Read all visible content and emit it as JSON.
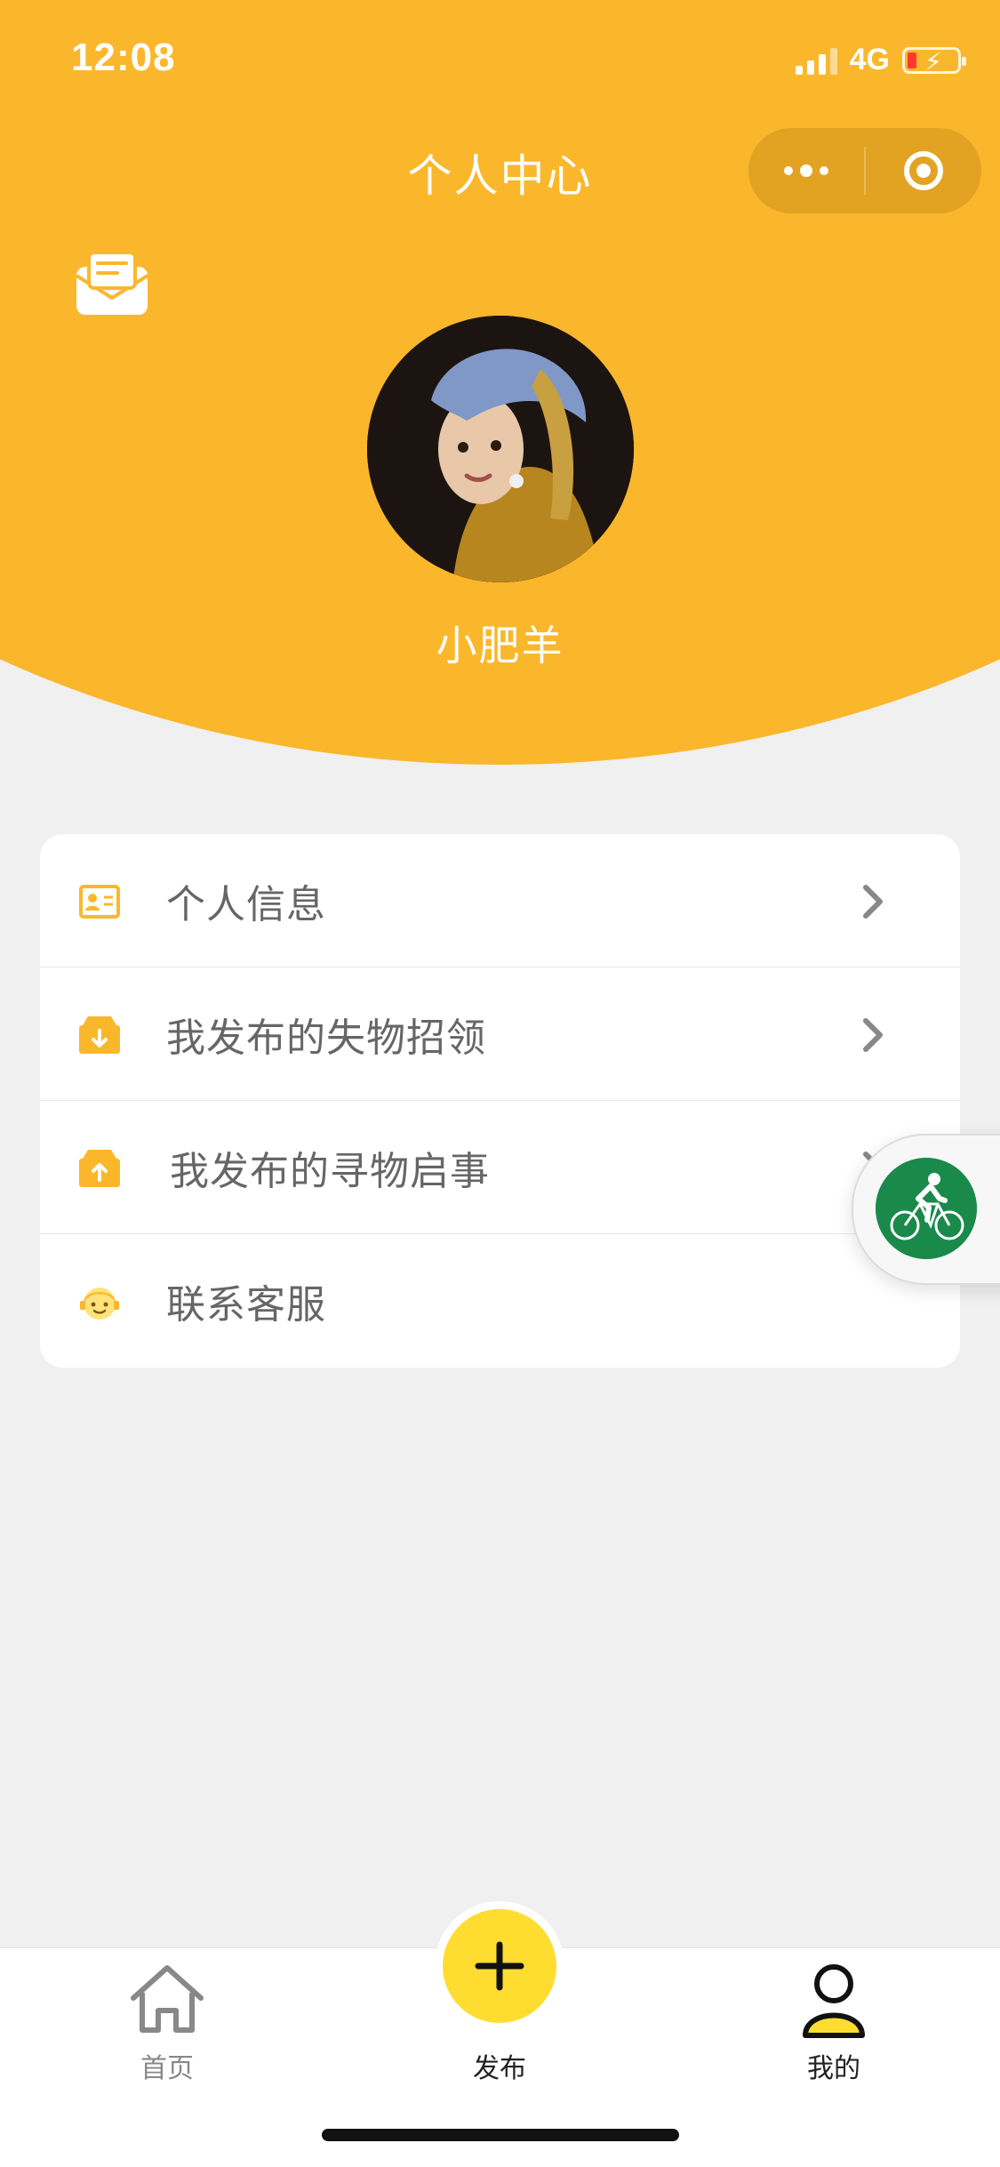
{
  "status_bar": {
    "time": "12:08",
    "network": "4G"
  },
  "header": {
    "title": "个人中心",
    "username": "小肥羊",
    "accent_color": "#fbb72c"
  },
  "menu": {
    "items": [
      {
        "label": "个人信息",
        "icon": "id-card-icon",
        "has_chevron": true
      },
      {
        "label": "我发布的失物招领",
        "icon": "box-download-icon",
        "has_chevron": true
      },
      {
        "label": "我发布的寻物启事",
        "icon": "box-upload-icon",
        "has_chevron": true
      },
      {
        "label": "联系客服",
        "icon": "customer-service-icon",
        "has_chevron": false
      }
    ]
  },
  "tab_bar": {
    "home_label": "首页",
    "publish_label": "发布",
    "mine_label": "我的",
    "active_tab": "我的",
    "publish_color": "#fedd30"
  }
}
